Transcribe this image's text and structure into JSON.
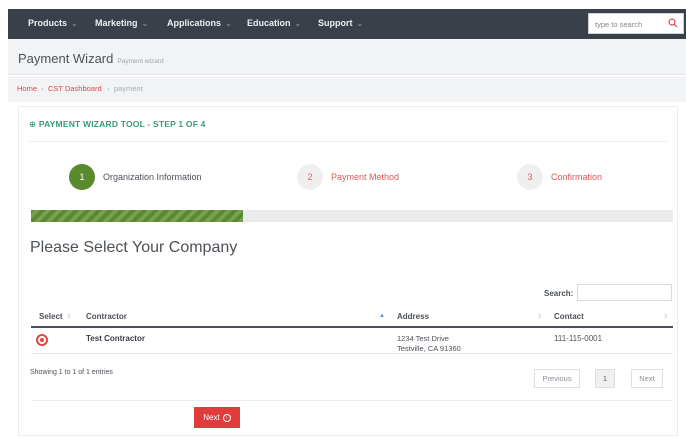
{
  "navbar": {
    "items": [
      {
        "label": "Products"
      },
      {
        "label": "Marketing"
      },
      {
        "label": "Applications"
      },
      {
        "label": "Education"
      },
      {
        "label": "Support"
      }
    ],
    "search_placeholder": "type to search"
  },
  "header": {
    "title": "Payment Wizard",
    "subtitle": "Payment wizard"
  },
  "breadcrumb": {
    "items": [
      "Home",
      "CST Dashboard",
      "payment"
    ]
  },
  "wizard": {
    "title": "PAYMENT WIZARD TOOL - STEP 1 OF 4",
    "steps": [
      {
        "number": "1",
        "label": "Organization Information",
        "active": true
      },
      {
        "number": "2",
        "label": "Payment Method",
        "active": false
      },
      {
        "number": "3",
        "label": "Confirmation",
        "active": false
      }
    ],
    "progress": 0.33
  },
  "section": {
    "heading": "Please Select Your Company"
  },
  "table": {
    "search_label": "Search:",
    "search_value": "",
    "columns": [
      "Select",
      "Contractor",
      "Address",
      "Contact"
    ],
    "rows": [
      {
        "contractor": "Test Contractor",
        "address_line1": "1234 Test Drive",
        "address_line2": "Testville, CA 91360",
        "contact": "111-115-0001"
      }
    ],
    "info": "Showing 1 to 1 of 1 entries",
    "pagination": {
      "previous": "Previous",
      "current": "1",
      "next": "Next"
    }
  },
  "actions": {
    "next_label": "Next"
  },
  "colors": {
    "topbar": "#3a4049",
    "accent_red": "#e04646",
    "step_active": "#5a8a2e",
    "title_green": "#3a9a7e"
  }
}
